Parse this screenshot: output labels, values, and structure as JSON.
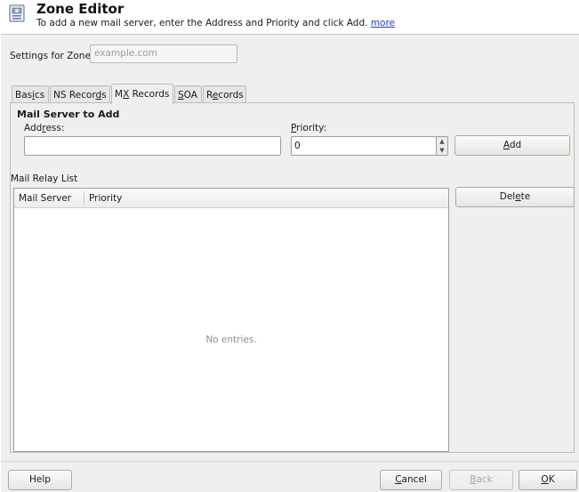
{
  "header": {
    "title": "Zone Editor",
    "subtitle": "To add a new mail server, enter the Address and Priority and click Add.",
    "more_link": "more"
  },
  "zone": {
    "label": "Settings for Zone",
    "placeholder": "example.com"
  },
  "tabs": [
    {
      "label": "Basics",
      "active": false
    },
    {
      "label": "NS Records",
      "active": false
    },
    {
      "label": "MX Records",
      "active": true
    },
    {
      "label": "SOA",
      "active": false
    },
    {
      "label": "Records",
      "active": false
    }
  ],
  "mx": {
    "section_title": "Mail Server to Add",
    "address_label": "Address:",
    "address_value": "",
    "priority_label": "Priority:",
    "priority_value": "0",
    "add_label": "Add"
  },
  "relay": {
    "list_label": "Mail Relay List",
    "columns": [
      "Mail Server",
      "Priority"
    ],
    "rows": [],
    "empty_text": "No entries.",
    "delete_label": "Delete"
  },
  "footer": {
    "help_label": "Help",
    "cancel_label": "Cancel",
    "back_label": "Back",
    "ok_label": "OK"
  }
}
